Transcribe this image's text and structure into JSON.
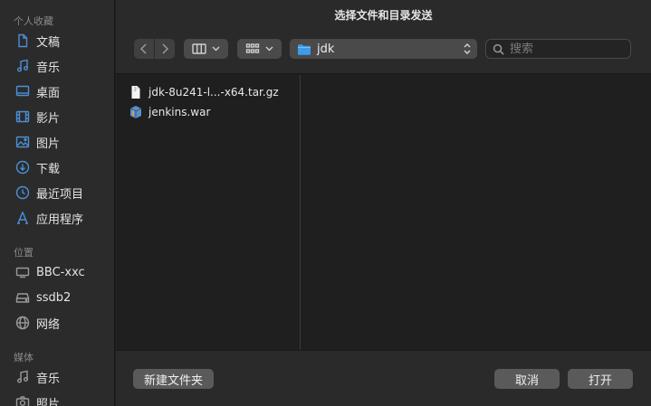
{
  "dialog": {
    "title": "选择文件和目录发送"
  },
  "sidebar": {
    "sections": [
      {
        "title": "个人收藏",
        "items": [
          {
            "label": "文稿",
            "icon": "document-icon"
          },
          {
            "label": "音乐",
            "icon": "music-icon"
          },
          {
            "label": "桌面",
            "icon": "desktop-icon"
          },
          {
            "label": "影片",
            "icon": "film-icon"
          },
          {
            "label": "图片",
            "icon": "photo-icon"
          },
          {
            "label": "下载",
            "icon": "download-icon"
          },
          {
            "label": "最近项目",
            "icon": "clock-icon"
          },
          {
            "label": "应用程序",
            "icon": "applications-icon"
          }
        ]
      },
      {
        "title": "位置",
        "items": [
          {
            "label": "BBC-xxc",
            "icon": "computer-icon"
          },
          {
            "label": "ssdb2",
            "icon": "drive-icon"
          },
          {
            "label": "网络",
            "icon": "network-icon"
          }
        ]
      },
      {
        "title": "媒体",
        "items": [
          {
            "label": "音乐",
            "icon": "music-icon"
          },
          {
            "label": "照片",
            "icon": "camera-icon"
          }
        ]
      }
    ]
  },
  "toolbar": {
    "path": {
      "folder": "jdk"
    },
    "search": {
      "placeholder": "搜索"
    }
  },
  "files": [
    {
      "name": "jdk-8u241-l...-x64.tar.gz",
      "icon": "archive-file-icon"
    },
    {
      "name": "jenkins.war",
      "icon": "war-file-icon"
    }
  ],
  "buttons": {
    "new_folder": "新建文件夹",
    "cancel": "取消",
    "open": "打开"
  },
  "colors": {
    "accent": "#4b8fd6",
    "background": "#1f1f1f",
    "sidebar": "#2b2b2b"
  }
}
